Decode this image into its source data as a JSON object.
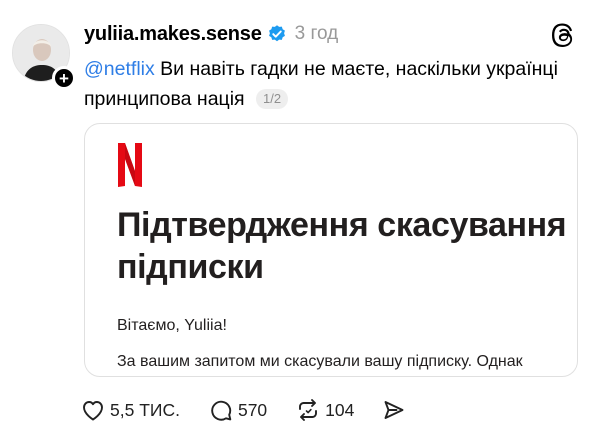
{
  "post": {
    "username": "yuliia.makes.sense",
    "time": "3 год",
    "mention": "@netflix",
    "text": " Ви навіть гадки не маєте, наскільки українці принципова нація",
    "pager": "1/2"
  },
  "card": {
    "logo": "N",
    "title": "Підтвердження скасування підписки",
    "greeting": "Вітаємо, Yuliia!",
    "body": "За вашим запитом ми скасували вашу підписку. Однак"
  },
  "actions": {
    "likes": "5,5 ТИС.",
    "replies": "570",
    "reposts": "104"
  },
  "colors": {
    "mention": "#2f7ee6",
    "verified": "#1d9bf0",
    "netflix_red": "#e50914",
    "muted": "#999999"
  },
  "icons": [
    "follow-plus-icon",
    "verified-badge-icon",
    "threads-logo-icon",
    "heart-icon",
    "comment-icon",
    "repost-icon",
    "share-icon"
  ]
}
